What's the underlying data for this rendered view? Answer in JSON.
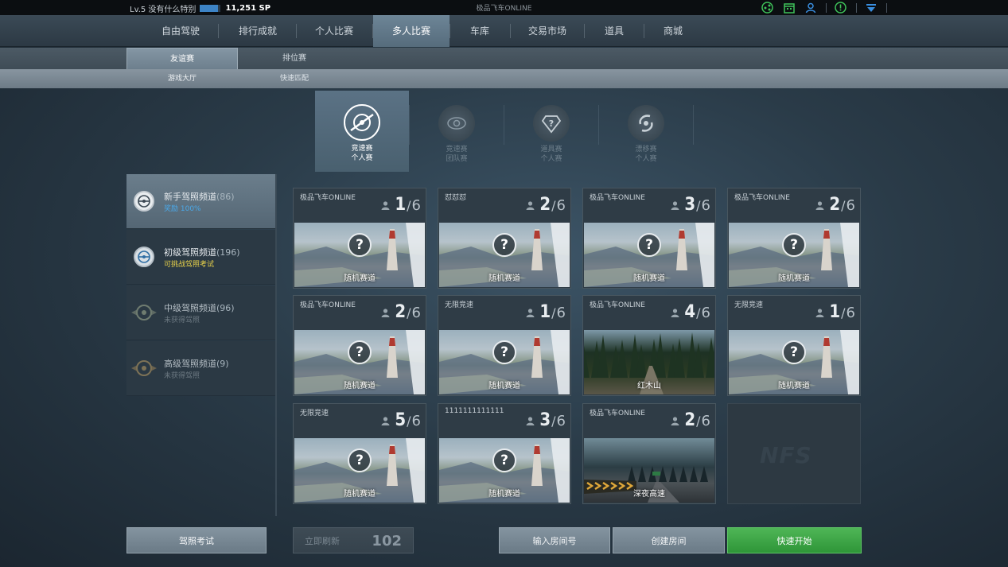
{
  "topbar": {
    "player": "Lv.5 没有什么特别",
    "xp_progress": 0.85,
    "sp": "11,251 SP",
    "title": "极品飞车ONLINE",
    "icons": [
      "share-icon",
      "calendar-icon",
      "user-icon",
      "alert-icon",
      "dropdown-icon"
    ]
  },
  "nav": {
    "items": [
      "自由驾驶",
      "排行成就",
      "个人比赛",
      "多人比赛",
      "车库",
      "交易市场",
      "道具",
      "商城"
    ],
    "active": "多人比赛"
  },
  "subnav": {
    "tabs": [
      "友谊赛",
      "排位赛"
    ],
    "active": "友谊赛",
    "subtabs": [
      "游戏大厅",
      "快速匹配"
    ]
  },
  "modes": [
    {
      "line1": "竞速赛",
      "line2": "个人赛",
      "icon": "speed-race-icon"
    },
    {
      "line1": "竞速赛",
      "line2": "团队赛",
      "icon": "team-race-icon"
    },
    {
      "line1": "道具赛",
      "line2": "个人赛",
      "icon": "item-race-icon"
    },
    {
      "line1": "漂移赛",
      "line2": "个人赛",
      "icon": "drift-race-icon"
    }
  ],
  "channels": [
    {
      "name": "新手驾照频道",
      "count": "(86)",
      "sub": "奖励 100%",
      "sub_color": "#4aa8e8"
    },
    {
      "name": "初级驾照频道",
      "count": "(196)",
      "sub": "可挑战驾照考试",
      "sub_color": "#e8d24a"
    },
    {
      "name": "中级驾照频道",
      "count": "(96)",
      "sub": "未获得驾照",
      "sub_color": "#6c7982"
    },
    {
      "name": "高级驾照频道",
      "count": "(9)",
      "sub": "未获得驾照",
      "sub_color": "#6c7982"
    }
  ],
  "rooms": [
    {
      "name": "极品飞车ONLINE",
      "players": "1",
      "max": "6",
      "track": "随机赛道",
      "thumb": "random"
    },
    {
      "name": "怼怼怼",
      "players": "2",
      "max": "6",
      "track": "随机赛道",
      "thumb": "random"
    },
    {
      "name": "极品飞车ONLINE",
      "players": "3",
      "max": "6",
      "track": "随机赛道",
      "thumb": "random"
    },
    {
      "name": "极品飞车ONLINE",
      "players": "2",
      "max": "6",
      "track": "随机赛道",
      "thumb": "random"
    },
    {
      "name": "极品飞车ONLINE",
      "players": "2",
      "max": "6",
      "track": "随机赛道",
      "thumb": "random"
    },
    {
      "name": "无限竞速",
      "players": "1",
      "max": "6",
      "track": "随机赛道",
      "thumb": "random"
    },
    {
      "name": "极品飞车ONLINE",
      "players": "4",
      "max": "6",
      "track": "红木山",
      "thumb": "forest"
    },
    {
      "name": "无限竞速",
      "players": "1",
      "max": "6",
      "track": "随机赛道",
      "thumb": "random"
    },
    {
      "name": "无限竞速",
      "players": "5",
      "max": "6",
      "track": "随机赛道",
      "thumb": "random"
    },
    {
      "name": "1111111111111",
      "players": "3",
      "max": "6",
      "track": "随机赛道",
      "thumb": "random"
    },
    {
      "name": "极品飞车ONLINE",
      "players": "2",
      "max": "6",
      "track": "深夜高速",
      "thumb": "night"
    }
  ],
  "empty_slot_logo": "NFS",
  "buttons": {
    "license_exam": "驾照考试",
    "refresh": "立即刷新",
    "refresh_count": "102",
    "enter_room": "输入房间号",
    "create_room": "创建房间",
    "quick_start": "快速开始"
  }
}
